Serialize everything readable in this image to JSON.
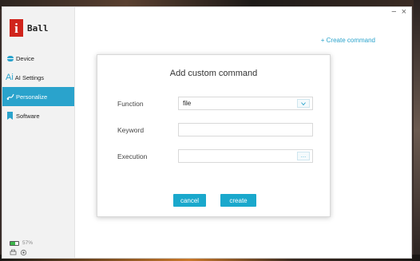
{
  "app": {
    "logo_text": "Ball",
    "logo_badge": "i"
  },
  "window_controls": {
    "minimize": "−",
    "close": "×"
  },
  "sidebar": {
    "items": [
      {
        "label": "Device",
        "icon": "device-icon",
        "active": false
      },
      {
        "label": "AI Settings",
        "icon": "ai-icon",
        "icon_text": "Ai",
        "active": false
      },
      {
        "label": "Personalize",
        "icon": "personalize-icon",
        "active": true
      },
      {
        "label": "Software",
        "icon": "software-icon",
        "active": false
      }
    ],
    "battery_percent": "57%",
    "battery_level": 0.57
  },
  "header": {
    "create_link": "+ Create command"
  },
  "dialog": {
    "title": "Add custom command",
    "fields": {
      "function": {
        "label": "Function",
        "value": "file"
      },
      "keyword": {
        "label": "Keyword",
        "value": ""
      },
      "execution": {
        "label": "Execution",
        "value": "",
        "browse": "…"
      }
    },
    "cancel_label": "cancel",
    "create_label": "create"
  },
  "colors": {
    "accent": "#2aa3cc",
    "button": "#1aa8cc",
    "logo_red": "#d0241c",
    "battery_green": "#3cb54a"
  }
}
